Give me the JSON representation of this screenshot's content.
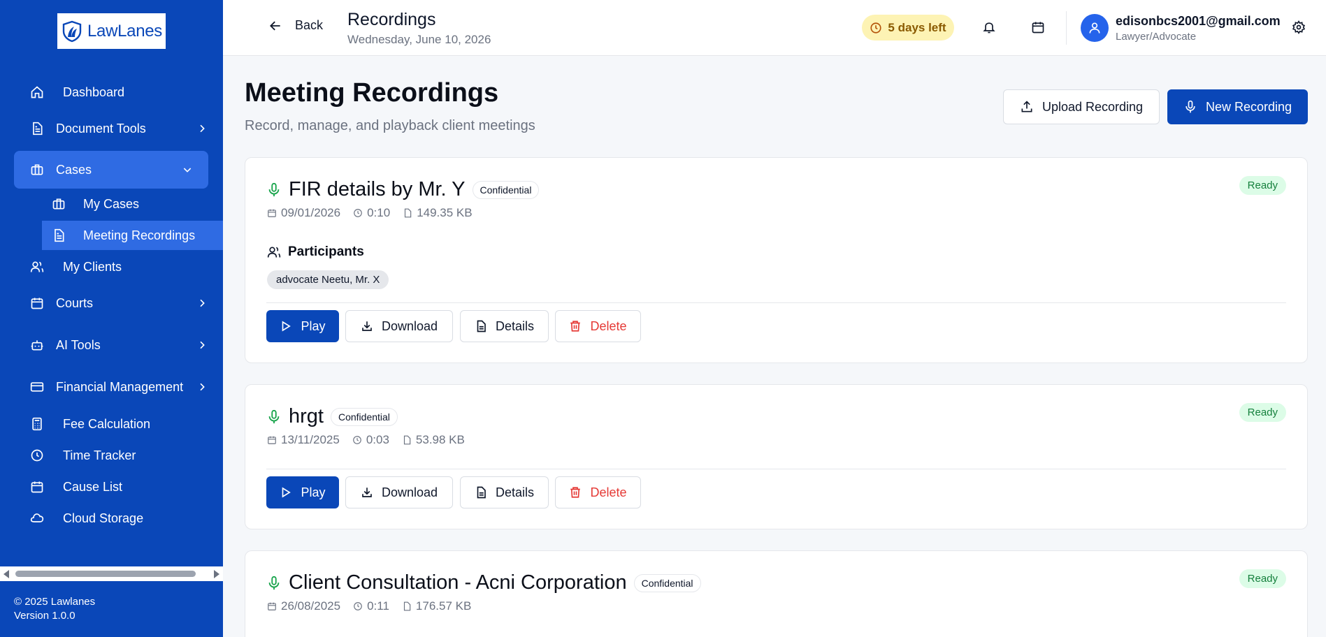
{
  "brand": {
    "name": "LawLanes",
    "accent": "#0a47b8"
  },
  "sidebar": {
    "items": [
      {
        "label": "Dashboard",
        "icon": "home-icon"
      },
      {
        "label": "Document Tools",
        "icon": "document-icon"
      },
      {
        "label": "Cases",
        "icon": "briefcase-icon"
      },
      {
        "label": "My Cases",
        "icon": "briefcase-icon"
      },
      {
        "label": "Meeting Recordings",
        "icon": "document-icon"
      },
      {
        "label": "My Clients",
        "icon": "users-icon"
      },
      {
        "label": "Courts",
        "icon": "calendar-icon"
      },
      {
        "label": "AI Tools",
        "icon": "bot-icon"
      },
      {
        "label": "Financial Management",
        "icon": "credit-card-icon"
      },
      {
        "label": "Fee Calculation",
        "icon": "calculator-icon"
      },
      {
        "label": "Time Tracker",
        "icon": "clock-icon"
      },
      {
        "label": "Cause List",
        "icon": "calendar-icon"
      },
      {
        "label": "Cloud Storage",
        "icon": "cloud-icon"
      }
    ],
    "footer": {
      "copyright": "© 2025 Lawlanes",
      "version": "Version 1.0.0"
    }
  },
  "header": {
    "back_label": "Back",
    "title": "Recordings",
    "date": "Wednesday, June 10, 2026",
    "trial_label": "5 days left",
    "user": {
      "email": "edisonbcs2001@gmail.com",
      "role": "Lawyer/Advocate"
    }
  },
  "main": {
    "title": "Meeting Recordings",
    "subtitle": "Record, manage, and playback client meetings",
    "upload_label": "Upload Recording",
    "new_label": "New Recording",
    "participants_label": "Participants",
    "actions": {
      "play": "Play",
      "download": "Download",
      "details": "Details",
      "delete": "Delete"
    },
    "recordings": [
      {
        "title": "FIR details by Mr. Y",
        "badge": "Confidential",
        "status": "Ready",
        "date": "09/01/2026",
        "duration": "0:10",
        "size": "149.35 KB",
        "participants": "advocate Neetu, Mr. X"
      },
      {
        "title": "hrgt",
        "badge": "Confidential",
        "status": "Ready",
        "date": "13/11/2025",
        "duration": "0:03",
        "size": "53.98 KB"
      },
      {
        "title": "Client Consultation - Acni Corporation",
        "badge": "Confidential",
        "status": "Ready",
        "date": "26/08/2025",
        "duration": "0:11",
        "size": "176.57 KB"
      }
    ]
  }
}
